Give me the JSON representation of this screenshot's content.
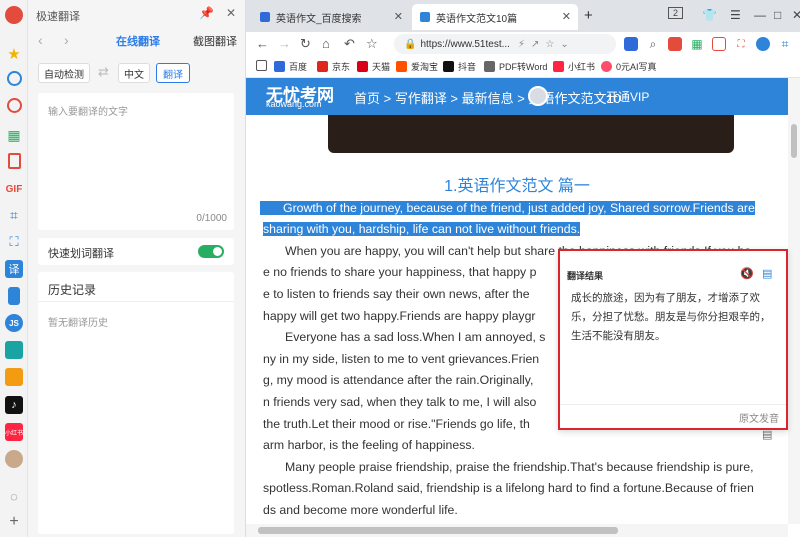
{
  "rail": {
    "icons": [
      "star-icon",
      "clock-icon",
      "record-icon",
      "apps-icon",
      "pdf-icon",
      "gif-icon",
      "crop-icon",
      "scan-icon",
      "translate-icon",
      "phone-icon",
      "js-icon",
      "monitor-icon",
      "game-icon",
      "tiktok-icon",
      "xiaohongshu-icon",
      "avatar-icon",
      "bulb-icon",
      "add-icon"
    ],
    "labels": {
      "gif": "GIF",
      "translate": "译",
      "xhs": "小红书"
    }
  },
  "panel": {
    "title": "极速翻译",
    "tab_online": "在线翻译",
    "tab_screenshot": "截图翻译",
    "source_lang": "自动检测",
    "target_lang": "中文",
    "translate_button": "翻译",
    "input_placeholder": "输入要翻译的文字",
    "char_count": "0/1000",
    "quick_translate_label": "快速划词翻译",
    "history_title": "历史记录",
    "history_empty": "暂无翻译历史"
  },
  "tabs": [
    {
      "title": "英语作文_百度搜索",
      "active": false
    },
    {
      "title": "英语作文范文10篇",
      "active": true
    }
  ],
  "window": {
    "badge": "2"
  },
  "toolbar": {
    "url": "https://www.51test..."
  },
  "bookmarks": [
    {
      "label": "百度",
      "color": "#2e6bd8"
    },
    {
      "label": "京东",
      "color": "#e1251b"
    },
    {
      "label": "天猫",
      "color": "#d90019"
    },
    {
      "label": "爱淘宝",
      "color": "#ff5000"
    },
    {
      "label": "抖音",
      "color": "#111111"
    },
    {
      "label": "PDF转Word",
      "color": "#666666"
    },
    {
      "label": "小红书",
      "color": "#ff2442"
    },
    {
      "label": "0元AI写真",
      "color": "#ff4d6a"
    }
  ],
  "site": {
    "logo_main": "无忧考网",
    "logo_sub": "kaowang.com",
    "nav": "首页 > 写作翻译 > 最新信息 > 英语作文范文10",
    "extra": "开通VIP"
  },
  "article": {
    "title": "1.英语作文范文 篇一",
    "lines": [
      "Growth of the journey, because of the friend, just added joy, Shared sorrow.Friends are",
      "sharing with you, hardship, life can not live without friends.",
      "When you are happy, you will can't help but share the happiness with friends.If you ha",
      "e no friends to share your happiness, that happy p",
      "e to listen to friends say their own news, after the",
      "happy will get two happy.Friends are happy playgr",
      "Everyone has a sad loss.When I am annoyed, s",
      "ny in my side, listen to me to vent grievances.Frien",
      "g, my mood is attendance after the rain.Originally,",
      "n friends very sad, when they talk to me, I will also",
      "the truth.Let their mood or rise.\"Friends go life, th",
      "arm harbor, is the feeling of happiness.",
      "Many people praise friendship, praise the friendship.That's because friendship is pure,",
      "spotless.Roman.Roland said, friendship is a lifelong hard to find a fortune.Because of frien",
      "ds and become more wonderful life."
    ]
  },
  "popup": {
    "header": "翻译结果",
    "result": "成长的旅途，因为有了朋友，才增添了欢乐，分担了忧愁。朋友是与你分担艰辛的，生活不能没有朋友。",
    "source_voice": "原文发音"
  }
}
